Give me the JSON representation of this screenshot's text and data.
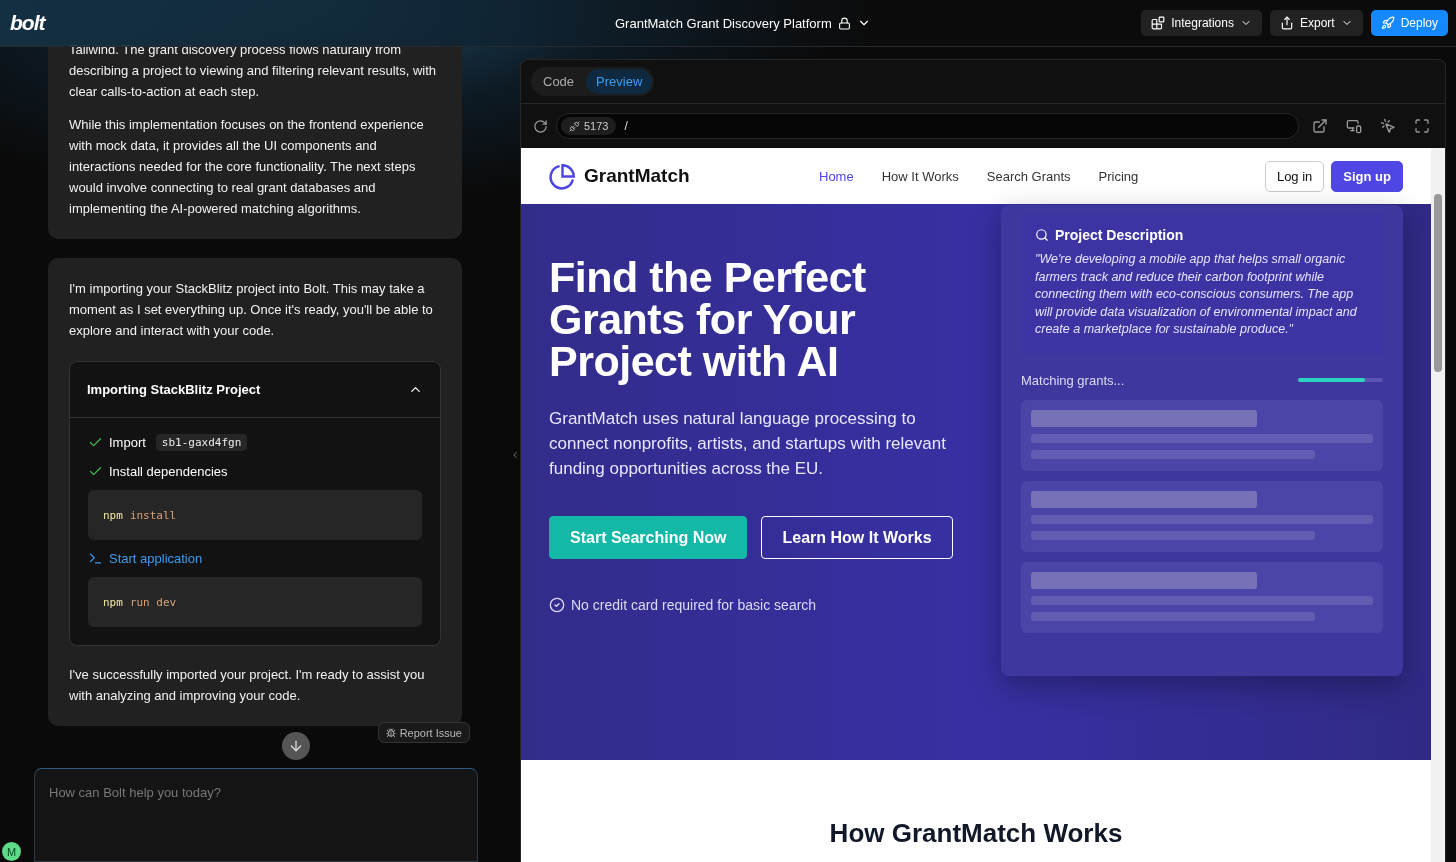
{
  "header": {
    "logo": "bolt",
    "project_title": "GrantMatch Grant Discovery Platform",
    "actions": [
      {
        "label": "Integrations",
        "kind": "integrations"
      },
      {
        "label": "Export",
        "kind": "export"
      },
      {
        "label": "Deploy",
        "kind": "deploy"
      }
    ]
  },
  "chat": {
    "messages": [
      {
        "paragraphs": [
          "Tailwind. The grant discovery process flows naturally from describing a project to viewing and filtering relevant results, with clear calls-to-action at each step.",
          "While this implementation focuses on the frontend experience with mock data, it provides all the UI components and interactions needed for the core functionality. The next steps would involve connecting to real grant databases and implementing the AI-powered matching algorithms."
        ]
      },
      {
        "paragraphs": [
          "I'm importing your StackBlitz project into Bolt. This may take a moment as I set everything up. Once it's ready, you'll be able to explore and interact with your code."
        ],
        "artifact": {
          "title": "Importing StackBlitz Project",
          "expanded": true,
          "steps": [
            {
              "done": true,
              "label": "Import",
              "tag": "sb1-gaxd4fgn"
            },
            {
              "done": true,
              "label": "Install dependencies",
              "command": {
                "program": "npm",
                "args": "install"
              }
            },
            {
              "done": false,
              "label": "Start application",
              "command": {
                "program": "npm",
                "args": "run dev"
              }
            }
          ]
        },
        "closing": "I've successfully imported your project. I'm ready to assist you with analyzing and improving your code."
      }
    ],
    "report_issue": "Report Issue",
    "input": {
      "placeholder": "How can Bolt help you today?"
    },
    "avatar": "M"
  },
  "workbench": {
    "tabs": [
      {
        "label": "Code",
        "selected": false
      },
      {
        "label": "Preview",
        "selected": true
      }
    ],
    "address": {
      "port": "5173",
      "path": "/"
    }
  },
  "preview": {
    "brand": "GrantMatch",
    "nav": [
      {
        "label": "Home",
        "selected": true
      },
      {
        "label": "How It Works",
        "selected": false
      },
      {
        "label": "Search Grants",
        "selected": false
      },
      {
        "label": "Pricing",
        "selected": false
      }
    ],
    "auth": [
      {
        "label": "Log in",
        "kind": "outline"
      },
      {
        "label": "Sign up",
        "kind": "solid"
      }
    ],
    "hero": {
      "title": "Find the Perfect Grants for Your Project with AI",
      "subtitle": "GrantMatch uses natural language processing to connect nonprofits, artists, and startups with relevant funding opportunities across the EU.",
      "buttons": [
        {
          "label": "Start Searching Now",
          "kind": "solid"
        },
        {
          "label": "Learn How It Works",
          "kind": "outline"
        }
      ],
      "note": "No credit card required for basic search",
      "demo": {
        "heading": "Project Description",
        "quote": "\"We're developing a mobile app that helps small organic farmers track and reduce their carbon footprint while connecting them with eco-conscious consumers. The app will provide data visualization of environmental impact and create a marketplace for sustainable produce.\"",
        "status": "Matching grants...",
        "progress": {
          "level": 0.79
        },
        "results": [
          {
            "kind": "skeleton"
          },
          {
            "kind": "skeleton"
          },
          {
            "kind": "skeleton"
          }
        ]
      }
    },
    "section_heading": "How GrantMatch Works"
  }
}
